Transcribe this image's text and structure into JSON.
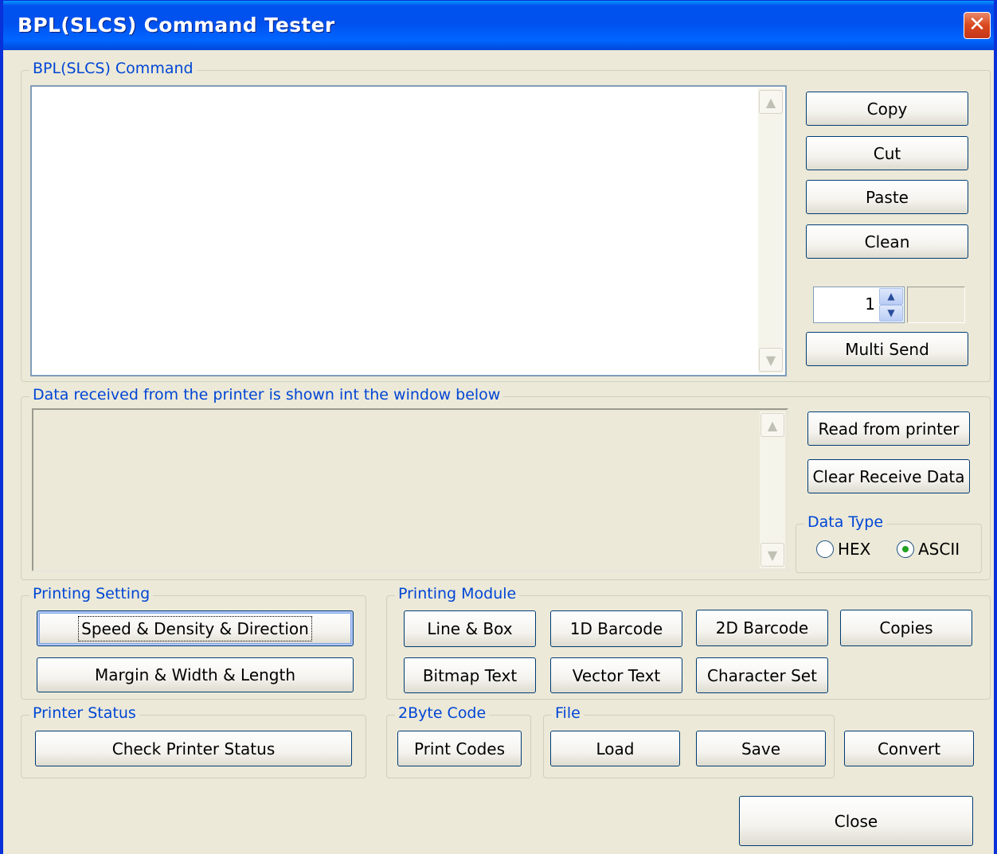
{
  "window": {
    "title": "BPL(SLCS) Command Tester",
    "close_glyph": "✕"
  },
  "command_group": {
    "legend": "BPL(SLCS) Command",
    "text": "",
    "buttons": {
      "copy": "Copy",
      "cut": "Cut",
      "paste": "Paste",
      "clean": "Clean",
      "multi_send": "Multi Send"
    },
    "spinner_value": "1"
  },
  "receive_group": {
    "legend": "Data received from the printer is shown int the window below",
    "text": "",
    "buttons": {
      "read": "Read from printer",
      "clear": "Clear Receive Data"
    },
    "data_type": {
      "legend": "Data Type",
      "options": [
        "HEX",
        "ASCII"
      ],
      "selected": "ASCII"
    }
  },
  "printing_setting": {
    "legend": "Printing Setting",
    "buttons": [
      "Speed & Density & Direction",
      "Margin & Width & Length"
    ]
  },
  "printing_module": {
    "legend": "Printing Module",
    "buttons": [
      "Line & Box",
      "1D Barcode",
      "2D Barcode",
      "Copies",
      "Bitmap Text",
      "Vector Text",
      "Character Set"
    ]
  },
  "printer_status": {
    "legend": "Printer Status",
    "button": "Check Printer Status"
  },
  "two_byte": {
    "legend": "2Byte Code",
    "button": "Print Codes"
  },
  "file": {
    "legend": "File",
    "buttons": [
      "Load",
      "Save"
    ]
  },
  "convert_button": "Convert",
  "close_button": "Close",
  "icons": {
    "scroll_up": "▲",
    "scroll_down": "▼"
  },
  "colors": {
    "title_bar": "#0053ee",
    "legend_text": "#0046d5",
    "window_bg": "#ece9d8"
  }
}
